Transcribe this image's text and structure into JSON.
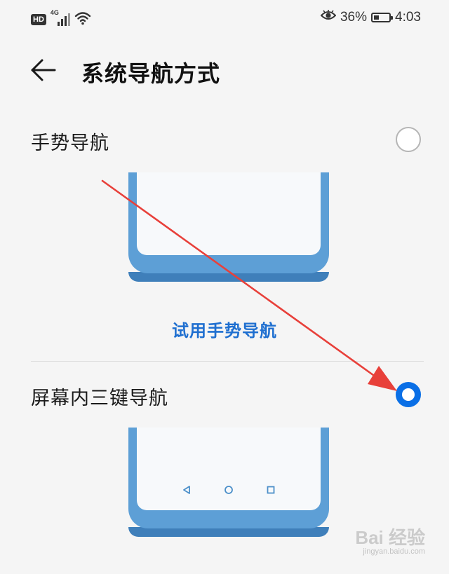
{
  "status_bar": {
    "hd_label": "HD",
    "network_label": "4G",
    "battery_percent": "36%",
    "battery_level": 0.36,
    "time": "4:03"
  },
  "header": {
    "title": "系统导航方式",
    "back_icon": "arrow-left-icon"
  },
  "options": [
    {
      "label": "手势导航",
      "selected": false
    },
    {
      "label": "屏幕内三键导航",
      "selected": true
    }
  ],
  "try_gesture_label": "试用手势导航",
  "colors": {
    "accent": "#0a6fe6",
    "link": "#1f6fd0",
    "phone_frame": "#5d9fd6",
    "annotation_arrow": "#e8403a"
  },
  "watermark": {
    "logo": "Bai 经验",
    "url": "jingyan.baidu.com"
  }
}
